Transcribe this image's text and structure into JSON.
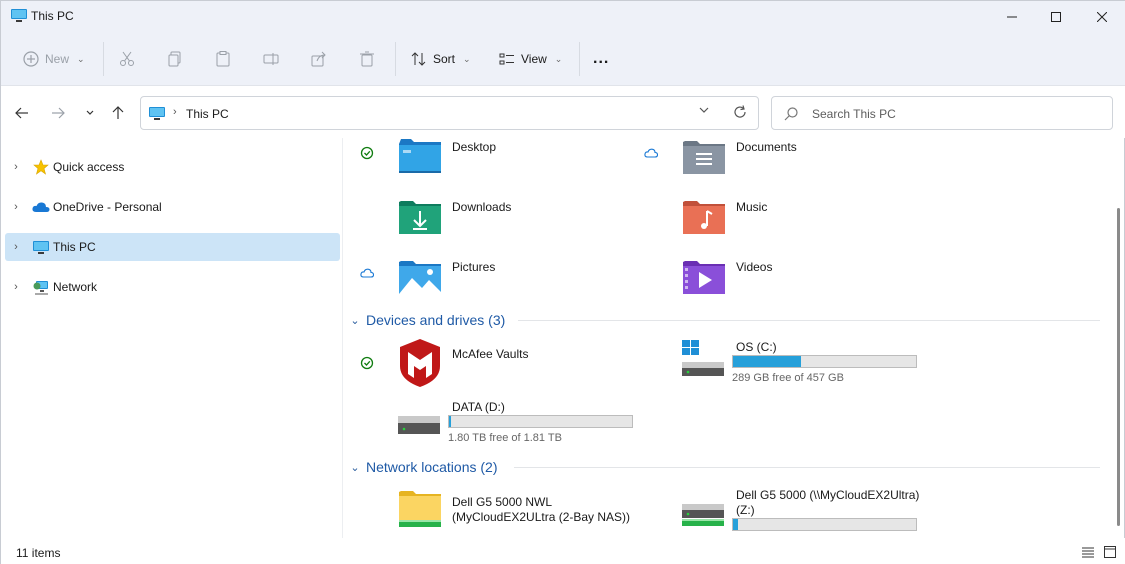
{
  "window": {
    "title": "This PC",
    "controls": [
      "minimize",
      "maximize",
      "close"
    ]
  },
  "toolbar": {
    "new_label": "New",
    "sort_label": "Sort",
    "view_label": "View",
    "more_label": "..."
  },
  "address": {
    "path": "This PC",
    "search_placeholder": "Search This PC"
  },
  "sidebar": {
    "items": [
      {
        "label": "Quick access",
        "icon": "star-icon"
      },
      {
        "label": "OneDrive - Personal",
        "icon": "cloud-icon"
      },
      {
        "label": "This PC",
        "icon": "monitor-icon",
        "selected": true
      },
      {
        "label": "Network",
        "icon": "network-icon"
      }
    ]
  },
  "folders": [
    {
      "name": "Desktop",
      "status": "synced"
    },
    {
      "name": "Documents",
      "status": "cloud"
    },
    {
      "name": "Downloads",
      "status": ""
    },
    {
      "name": "Music",
      "status": ""
    },
    {
      "name": "Pictures",
      "status": "cloud"
    },
    {
      "name": "Videos",
      "status": ""
    }
  ],
  "devices": {
    "title": "Devices and drives (3)",
    "items": [
      {
        "name": "McAfee Vaults",
        "status": "synced"
      },
      {
        "name": "OS (C:)",
        "free": "289 GB free of 457 GB",
        "used_fraction": 0.37
      },
      {
        "name": "DATA (D:)",
        "free": "1.80 TB free of 1.81 TB",
        "used_fraction": 0.01
      }
    ]
  },
  "network": {
    "title": "Network locations (2)",
    "items": [
      {
        "name_line1": "Dell G5 5000 NWL",
        "name_line2": "(MyCloudEX2ULtra (2-Bay NAS))"
      },
      {
        "name_line1": "Dell G5 5000 (\\\\MyCloudEX2Ultra)",
        "name_line2": "(Z:)",
        "used_fraction": 0.03
      }
    ]
  },
  "status": {
    "items_count": "11 items"
  },
  "colors": {
    "accent": "#26a0da",
    "selection": "#cce4f7",
    "section_title": "#1f5aa6",
    "chrome": "#eef1f8"
  }
}
